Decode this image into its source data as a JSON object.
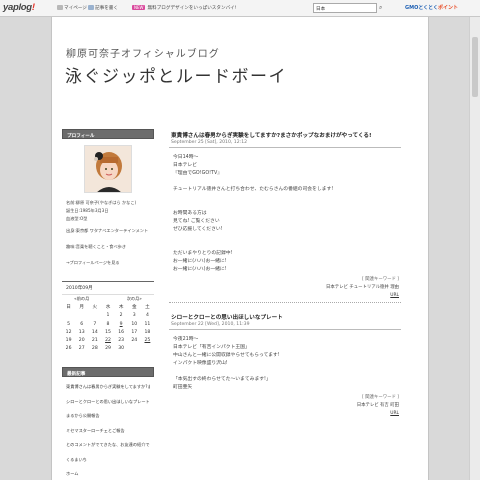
{
  "toolbar": {
    "logo_text": "yaplog",
    "logo_dot": "!",
    "my_page": "マイページ",
    "new_post": "記事を書く",
    "ad_badge": "NEW",
    "ad_text": "無料ブログデザインをいっぱいスタンバイ!",
    "search_value": "日本",
    "gmo_text": "GMOとくとく",
    "gmo_points": "ポイント"
  },
  "header": {
    "subtitle": "柳原可奈子オフィシャルブログ",
    "title": "泳ぐジッポとルードボーイ"
  },
  "sidebar": {
    "profile_heading": "プロフィール",
    "profile_lines": [
      "名前:柳原 可奈子(やなぎはら かなこ)",
      "誕生日:1985年3月3日",
      "血液型:O型",
      "出身:東京都 ワタナベエンターテインメント",
      "趣味:音楽を聴くこと・食べ歩き",
      "→プロフィールページを見る"
    ],
    "calendar_title": "2010年09月",
    "calendar_nav": {
      "prev": "«前の月",
      "next": "次の月»"
    },
    "weekdays": [
      "日",
      "月",
      "火",
      "水",
      "木",
      "金",
      "土"
    ],
    "weeks": [
      [
        "",
        "",
        "",
        "1",
        "2",
        "3",
        "4"
      ],
      [
        "5",
        "6",
        "7",
        "8",
        "9",
        "10",
        "11"
      ],
      [
        "12",
        "13",
        "14",
        "15",
        "16",
        "17",
        "18"
      ],
      [
        "19",
        "20",
        "21",
        "22",
        "23",
        "24",
        "25"
      ],
      [
        "26",
        "27",
        "28",
        "29",
        "30",
        "",
        ""
      ]
    ],
    "recent_heading": "最新記事",
    "recent": [
      "東貴博さんは春男からぎ実験をしてますか?まさかポップなおまけがやってくる!",
      "シローとクローとの思い出ほしいなプレート",
      "まるから公開報告",
      "ミセマスターローチェとご報告",
      "とのコメントがでてきたな、お友達の紹介です",
      "くるまいち",
      "ホーム"
    ]
  },
  "entries": [
    {
      "title": "東貴博さんは春男からぎ実験をしてますか?まさかポップなおまけがやってくる!",
      "date": "September 25 [Sat], 2010, 12:12",
      "lines": [
        "今日14時〜",
        "日本テレビ",
        "『理由でGO!GO!TV』",
        "",
        "チュートリアル徳井さんと打ち合わせ、たむらさんの番組の司会をします!",
        "",
        "",
        "お時間ある方は",
        "見てね! ご覧ください",
        "ぜひ応援してください!",
        "",
        "",
        "ただいまやりとりの記録中!",
        "お一緒に(ハハ)お一緒に!",
        "お一緒に(ハハ)お一緒に!"
      ],
      "keywords_label": "[ 関連キーワード ]",
      "keywords": "日本テレビ チュートリアル徳井 理由",
      "url_label": "URL"
    },
    {
      "title": "シローとクローとの思い出ほしいなプレート",
      "date": "September 22 [Wed], 2010, 11:39",
      "lines": [
        "今夜21時〜",
        "日本テレビ「有吉インパクト王国」",
        "中山さんと一緒に公開収録やらせてもらってます!",
        "インパクト映像盛り沢山!",
        "",
        "「本気出すの終わらせてた〜いまてみます!」",
        "町田亜矢"
      ],
      "keywords_label": "[ 関連キーワード ]",
      "keywords": "日本テレビ 有吉 町田",
      "url_label": "URL"
    }
  ]
}
